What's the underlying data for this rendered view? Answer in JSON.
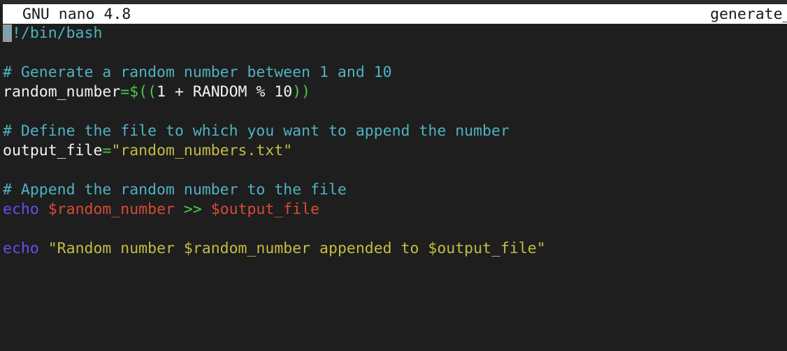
{
  "titlebar": {
    "app_title": "GNU nano 4.8",
    "filename": "generate_"
  },
  "editor": {
    "lines": [
      {
        "cursor": "#",
        "rest": "!/bin/bash"
      },
      {
        "text": ""
      },
      {
        "comment": "# Generate a random number between 1 and 10"
      },
      {
        "var": "random_number",
        "op": "=$((",
        "expr": "1 + RANDOM % 10",
        "close": "))"
      },
      {
        "text": ""
      },
      {
        "comment": "# Define the file to which you want to append the number"
      },
      {
        "var": "output_file",
        "op": "=",
        "str": "\"random_numbers.txt\""
      },
      {
        "text": ""
      },
      {
        "comment": "# Append the random number to the file"
      },
      {
        "kw": "echo",
        "v1": "$random_number",
        "redir": ">>",
        "v2": "$output_file"
      },
      {
        "text": ""
      },
      {
        "kw": "echo",
        "str": "\"Random number $random_number appended to $output_file\""
      }
    ]
  },
  "colors": {
    "background": "#1e1e1e",
    "comment": "#4fb2c2",
    "keyword": "#6a4cf0",
    "variable": "#d94a35",
    "string": "#c3bd44",
    "operator": "#4cc94c"
  }
}
